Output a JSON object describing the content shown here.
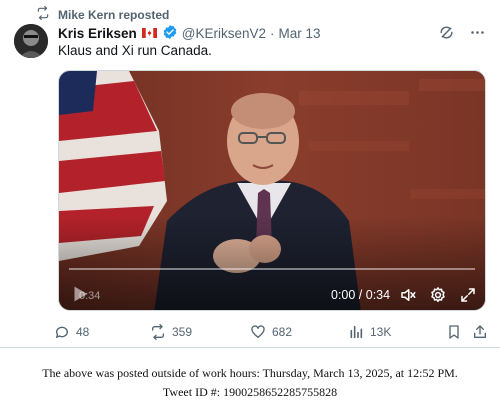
{
  "repost": {
    "label": "Mike Kern reposted",
    "icon": "repost-icon"
  },
  "tweet": {
    "author_name": "Kris Eriksen",
    "flag": "canada-flag-icon",
    "verified": "verified-badge-icon",
    "handle": "@KEriksenV2",
    "separator": "·",
    "date": "Mar 13",
    "text": "Klaus and Xi run Canada."
  },
  "video": {
    "ghost_time": "0:34",
    "time": "0:00 / 0:34",
    "progress": 0
  },
  "actions": {
    "replies": "48",
    "reposts": "359",
    "likes": "682",
    "views": "13K"
  },
  "footer": {
    "line1": "The above was posted outside of work hours: Thursday, March 13, 2025, at 12:52 PM.",
    "line2": "Tweet ID #: 1900258652285755828"
  },
  "colors": {
    "accent": "#1d9bf0",
    "muted": "#536471",
    "text": "#0f1419",
    "divider": "#cfd9de"
  }
}
